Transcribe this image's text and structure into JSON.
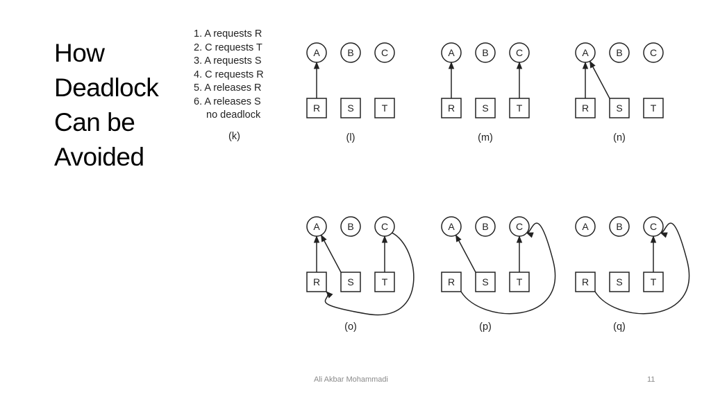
{
  "slide": {
    "title_lines": [
      "How",
      "Deadlock",
      "Can be",
      "Avoided"
    ],
    "footer_author": "Ali Akbar Mohammadi",
    "page_number": "11"
  },
  "steps": [
    "1. A requests R",
    "2. C requests T",
    "3. A requests S",
    "4. C requests R",
    "5. A releases R",
    "6. A releases S",
    "no deadlock"
  ],
  "steps_panel_label": "(k)",
  "processes": [
    "A",
    "B",
    "C"
  ],
  "resources": [
    "R",
    "S",
    "T"
  ],
  "panels": [
    {
      "label": "(l)",
      "assignments": [
        {
          "from": "R",
          "to": "A"
        }
      ],
      "requests": []
    },
    {
      "label": "(m)",
      "assignments": [
        {
          "from": "R",
          "to": "A"
        },
        {
          "from": "T",
          "to": "C"
        }
      ],
      "requests": []
    },
    {
      "label": "(n)",
      "assignments": [
        {
          "from": "R",
          "to": "A"
        },
        {
          "from": "S",
          "to": "A"
        }
      ],
      "requests": []
    },
    {
      "label": "(o)",
      "assignments": [
        {
          "from": "R",
          "to": "A"
        },
        {
          "from": "S",
          "to": "A"
        },
        {
          "from": "T",
          "to": "C"
        }
      ],
      "requests": [
        {
          "from": "C",
          "to": "R"
        }
      ]
    },
    {
      "label": "(p)",
      "assignments": [
        {
          "from": "S",
          "to": "A"
        },
        {
          "from": "T",
          "to": "C"
        },
        {
          "from": "R",
          "to": "C"
        }
      ],
      "requests": []
    },
    {
      "label": "(q)",
      "assignments": [
        {
          "from": "T",
          "to": "C"
        },
        {
          "from": "R",
          "to": "C"
        }
      ],
      "requests": []
    }
  ]
}
